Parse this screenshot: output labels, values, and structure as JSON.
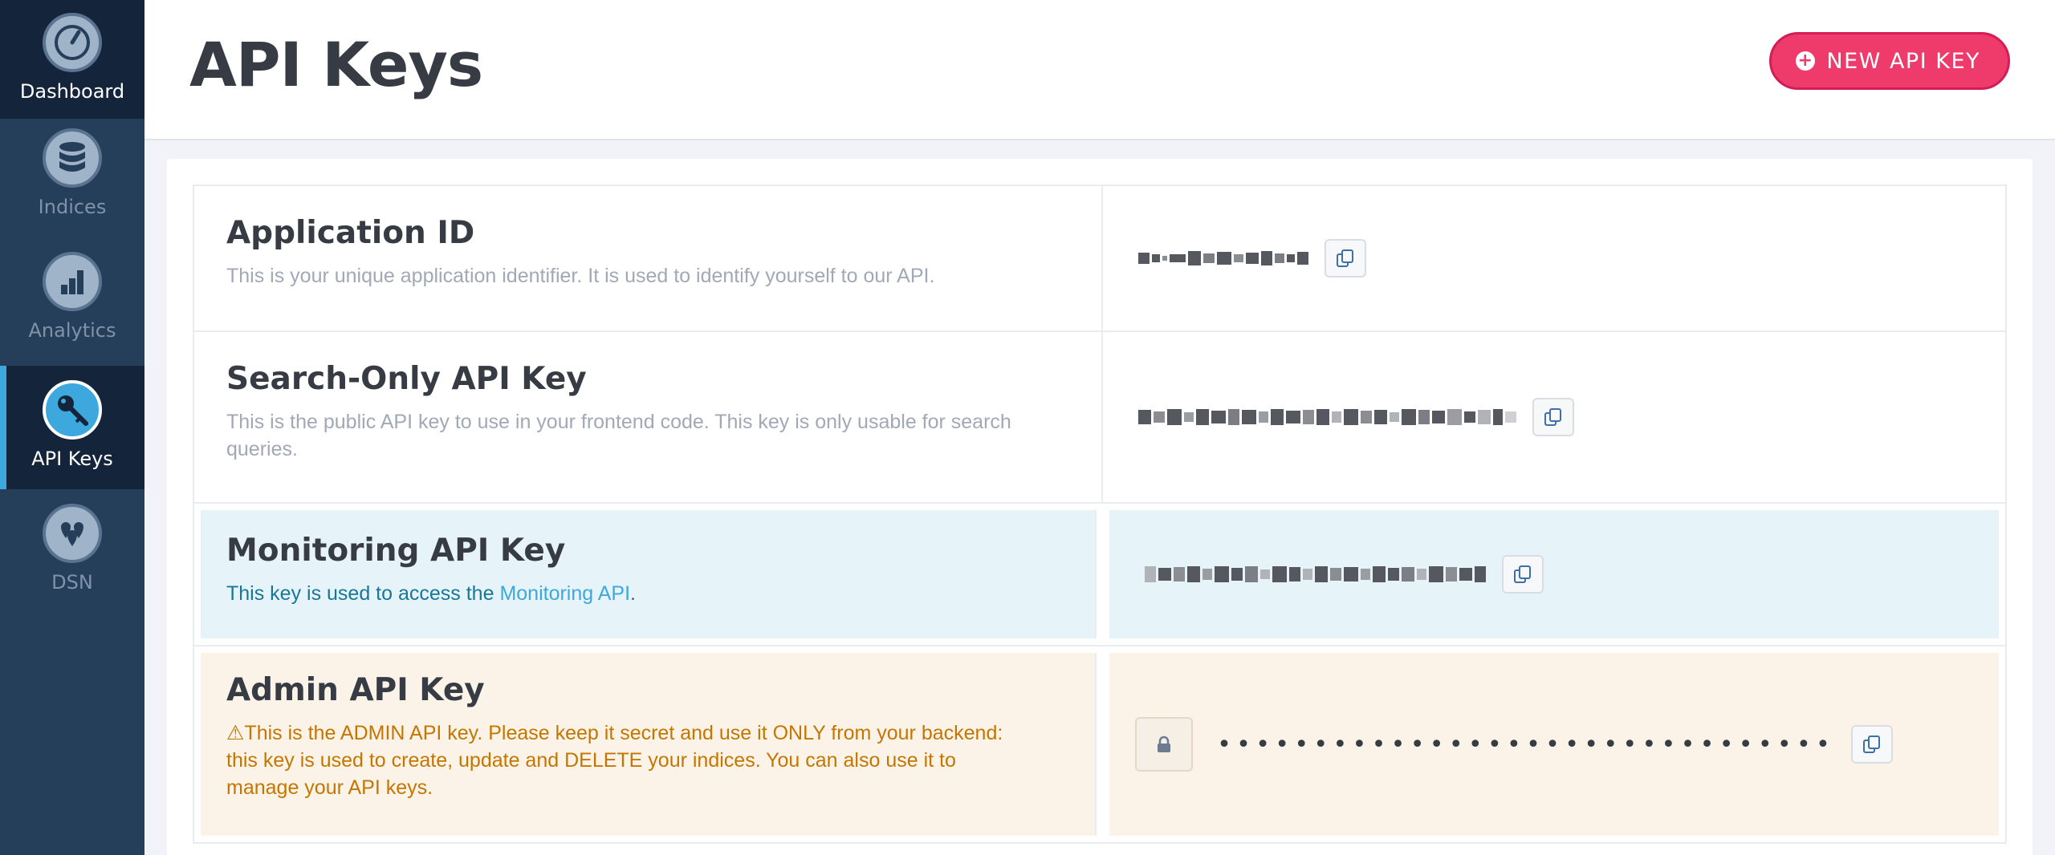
{
  "sidebar": {
    "items": [
      {
        "label": "Dashboard",
        "icon": "speedometer-icon"
      },
      {
        "label": "Indices",
        "icon": "database-icon"
      },
      {
        "label": "Analytics",
        "icon": "bar-chart-icon"
      },
      {
        "label": "API Keys",
        "icon": "key-icon",
        "active": true
      },
      {
        "label": "DSN",
        "icon": "map-pins-icon"
      }
    ]
  },
  "header": {
    "title": "API Keys",
    "new_key_label": "NEW API KEY"
  },
  "keys": {
    "app_id": {
      "title": "Application ID",
      "desc": "This is your unique application identifier. It is used to identify yourself to our API."
    },
    "search_only": {
      "title": "Search-Only API Key",
      "desc": "This is the public API key to use in your frontend code. This key is only usable for search queries."
    },
    "monitoring": {
      "title": "Monitoring API Key",
      "desc_prefix": "This key is used to access the ",
      "desc_link": "Monitoring API",
      "desc_suffix": "."
    },
    "admin": {
      "title": "Admin API Key",
      "warning_icon": "⚠",
      "desc": "This is the ADMIN API key. Please keep it secret and use it ONLY from your backend: this key is used to create, update and DELETE your indices. You can also use it to manage your API keys.",
      "masked_value": "••••••••••••••••••••••••••••••••"
    }
  },
  "colors": {
    "sidebar": "#253e5a",
    "sidebar_active": "#14243a",
    "accent_blue": "#3da8dd",
    "button_pink": "#ee3b6c",
    "monitoring_bg": "#e6f4fa",
    "admin_bg": "#fcf3e8"
  }
}
